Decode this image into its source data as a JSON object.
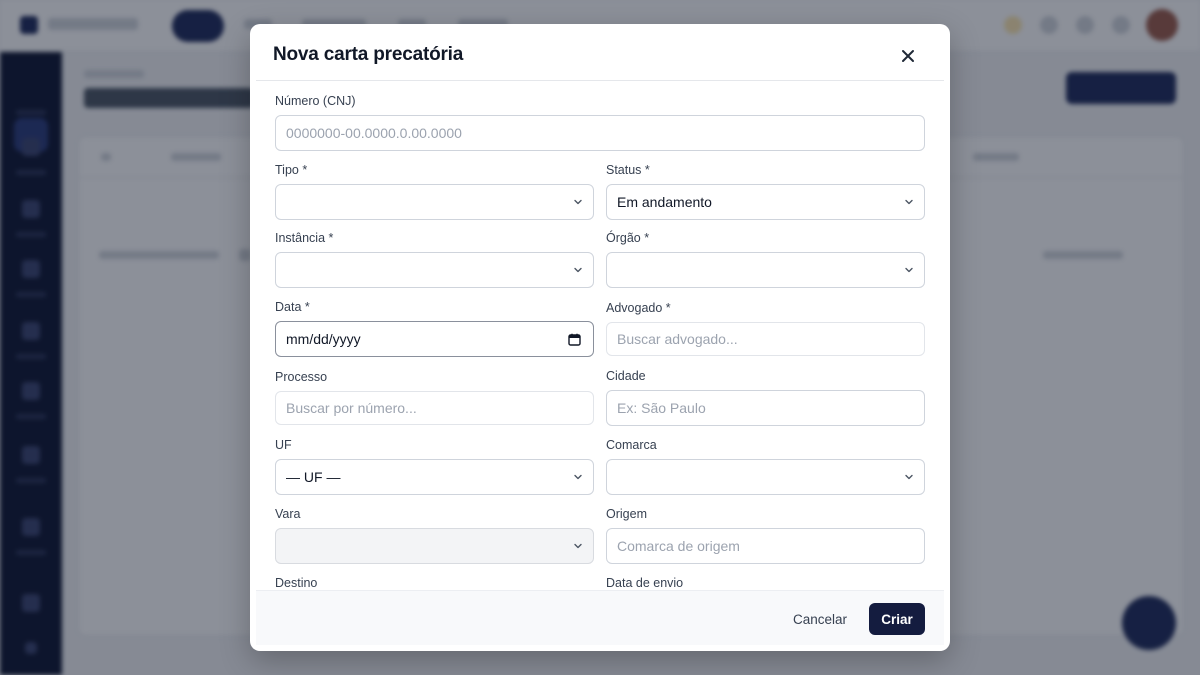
{
  "modal": {
    "title": "Nova carta precatória",
    "fields": {
      "numero": {
        "label": "Número (CNJ)",
        "placeholder": "0000000-00.0000.0.00.0000",
        "value": ""
      },
      "tipo": {
        "label": "Tipo *",
        "value": ""
      },
      "status": {
        "label": "Status *",
        "value": "Em andamento"
      },
      "instancia": {
        "label": "Instância *",
        "value": ""
      },
      "orgao": {
        "label": "Órgão *",
        "value": ""
      },
      "data": {
        "label": "Data *",
        "value": "mm/dd/yyyy"
      },
      "advogado": {
        "label": "Advogado *",
        "placeholder": "Buscar advogado..."
      },
      "processo": {
        "label": "Processo",
        "placeholder": "Buscar por número..."
      },
      "cidade": {
        "label": "Cidade",
        "placeholder": "Ex: São Paulo"
      },
      "uf": {
        "label": "UF",
        "value": "— UF —"
      },
      "comarca": {
        "label": "Comarca",
        "value": ""
      },
      "vara": {
        "label": "Vara",
        "value": ""
      },
      "origem": {
        "label": "Origem",
        "placeholder": "Comarca de origem"
      },
      "destino": {
        "label": "Destino"
      },
      "data_envio": {
        "label": "Data de envio"
      }
    },
    "footer": {
      "cancel_label": "Cancelar",
      "create_label": "Criar"
    }
  },
  "icons": {
    "close": "close-icon",
    "chevron": "chevron-down-icon",
    "calendar": "calendar-icon"
  },
  "colors": {
    "primary": "#141c3f",
    "sidebar": "#0d1430",
    "overlay": "rgba(15,23,42,0.48)"
  }
}
